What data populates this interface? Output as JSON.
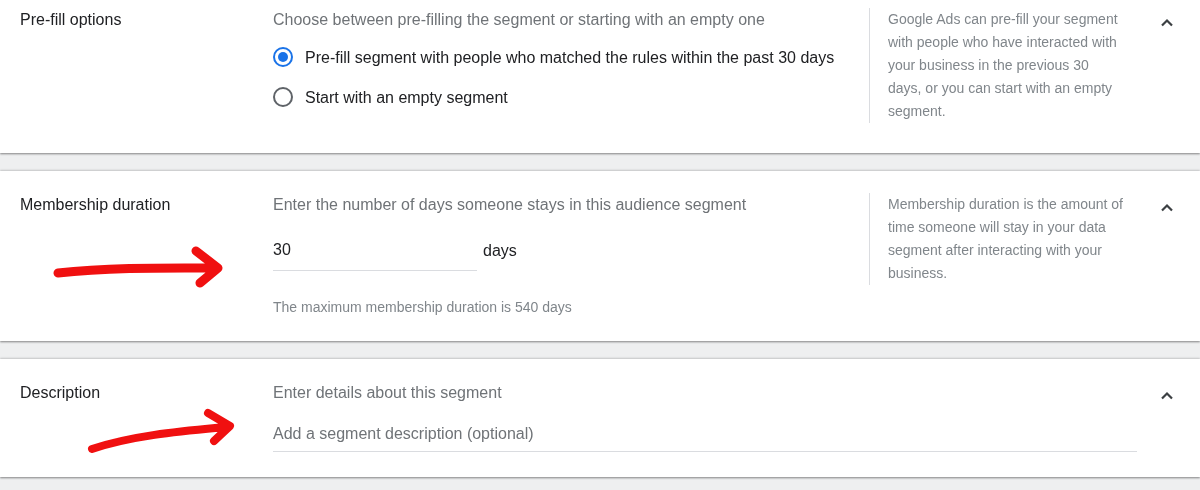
{
  "sections": [
    {
      "kind": "radio",
      "title": "Pre-fill options",
      "expanded": true,
      "annotated": false,
      "prompt": "Choose between pre-filling the segment or starting with an empty one",
      "options": [
        {
          "label": "Pre-fill segment with people who matched the rules within the past 30 days",
          "selected": true
        },
        {
          "label": "Start with an empty segment",
          "selected": false
        }
      ],
      "help": "Google Ads can pre-fill your segment with people who have interacted with your business in the previous 30 days, or you can start with an empty segment."
    },
    {
      "kind": "number",
      "title": "Membership duration",
      "expanded": true,
      "annotated": true,
      "prompt": "Enter the number of days someone stays in this audience segment",
      "value": "30",
      "unit": "days",
      "hint": "The maximum membership duration is 540 days",
      "help": "Membership duration is the amount of time someone will stay in your data segment after interacting with your business."
    },
    {
      "kind": "text",
      "title": "Description",
      "expanded": true,
      "annotated": true,
      "prompt": "Enter details about this segment",
      "placeholder": "Add a segment description (optional)"
    }
  ]
}
